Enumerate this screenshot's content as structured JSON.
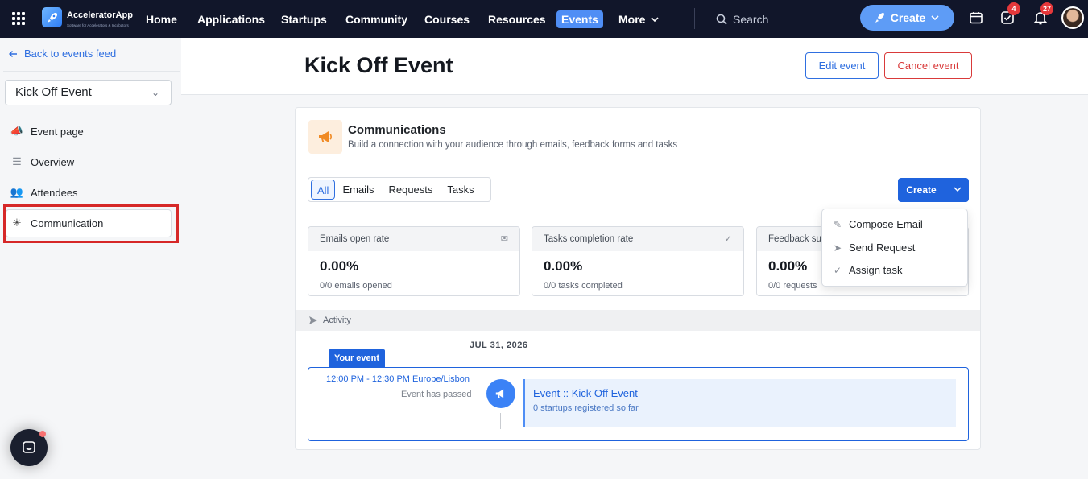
{
  "app": {
    "name": "AcceleratorApp",
    "tagline": "Software for Accelerators & Incubators"
  },
  "nav": {
    "items": [
      "Home",
      "Applications",
      "Startups",
      "Community",
      "Courses",
      "Resources",
      "Events",
      "More"
    ],
    "active": "Events",
    "search_placeholder": "Search",
    "create_label": "Create",
    "tasks_badge": "4",
    "notifications_badge": "27"
  },
  "sidebar": {
    "back_label": "Back to events feed",
    "event_select": "Kick Off Event",
    "items": [
      "Event page",
      "Overview",
      "Attendees",
      "Communication"
    ],
    "active": "Communication"
  },
  "page": {
    "title": "Kick Off Event",
    "edit_label": "Edit event",
    "cancel_label": "Cancel event"
  },
  "communications": {
    "title": "Communications",
    "description": "Build a connection with your audience through emails, feedback forms and tasks",
    "tabs": [
      "All",
      "Emails",
      "Requests",
      "Tasks"
    ],
    "active_tab": "All",
    "create_label": "Create",
    "stats": [
      {
        "label": "Emails open rate",
        "value": "0.00%",
        "sub": "0/0 emails opened",
        "icon": "envelope-open-icon"
      },
      {
        "label": "Tasks completion rate",
        "value": "0.00%",
        "sub": "0/0 tasks completed",
        "icon": "check-icon"
      },
      {
        "label": "Feedback su",
        "value": "0.00%",
        "sub": "0/0 requests",
        "icon": ""
      }
    ],
    "dropdown": [
      "Compose Email",
      "Send Request",
      "Assign task"
    ]
  },
  "activity": {
    "label": "Activity",
    "date": "JUL 31, 2026",
    "your_event_label": "Your event",
    "time": "12:00 PM - 12:30 PM Europe/Lisbon",
    "status": "Event has passed",
    "event_title": "Event :: Kick Off Event",
    "event_sub": "0 startups registered so far"
  },
  "colors": {
    "nav_bg": "#11162a",
    "accent": "#1f63dd",
    "danger": "#d93a3a",
    "highlight": "#d62828"
  }
}
